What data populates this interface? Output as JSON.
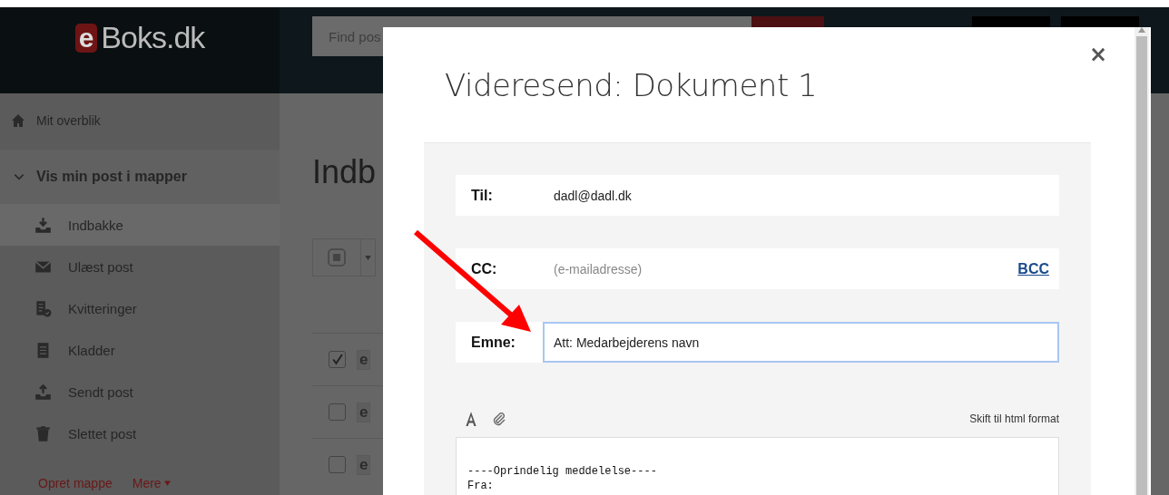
{
  "header": {
    "logo_mark": "e",
    "logo_text": "Boks.dk",
    "search": {
      "placeholder": "Find pos"
    }
  },
  "sidebar": {
    "overview": "Mit overblik",
    "section": {
      "label": "Vis min post i mapper",
      "expanded": true
    },
    "items": [
      {
        "kind": "inbox",
        "label": "Indbakke",
        "selected": true
      },
      {
        "kind": "unread",
        "label": "Ulæst post",
        "selected": false
      },
      {
        "kind": "receipts",
        "label": "Kvitteringer",
        "selected": false
      },
      {
        "kind": "drafts",
        "label": "Kladder",
        "selected": false
      },
      {
        "kind": "sent",
        "label": "Sendt post",
        "selected": false
      },
      {
        "kind": "deleted",
        "label": "Slettet post",
        "selected": false
      }
    ],
    "links": [
      {
        "label": "Opret mappe",
        "dropdown": false
      },
      {
        "label": "Mere",
        "dropdown": true
      }
    ]
  },
  "main": {
    "title": "Indb",
    "rows": [
      {
        "checked": true,
        "badge": "e"
      },
      {
        "checked": false,
        "badge": "e"
      },
      {
        "checked": false,
        "badge": "e"
      }
    ]
  },
  "modal": {
    "title": "Videresend: Dokument 1",
    "close": "×",
    "fields": [
      {
        "kind": "to",
        "label": "Til:",
        "value": "dadl@dadl.dk"
      },
      {
        "kind": "cc",
        "label": "CC:",
        "placeholder": "(e-mailadresse)",
        "link": "BCC"
      },
      {
        "kind": "subject",
        "label": "Emne:",
        "value": "Att: Medarbejderens navn",
        "focused": true
      }
    ],
    "format_link": "Skift til html format",
    "body": "----Oprindelig meddelelse----\nFra:"
  }
}
